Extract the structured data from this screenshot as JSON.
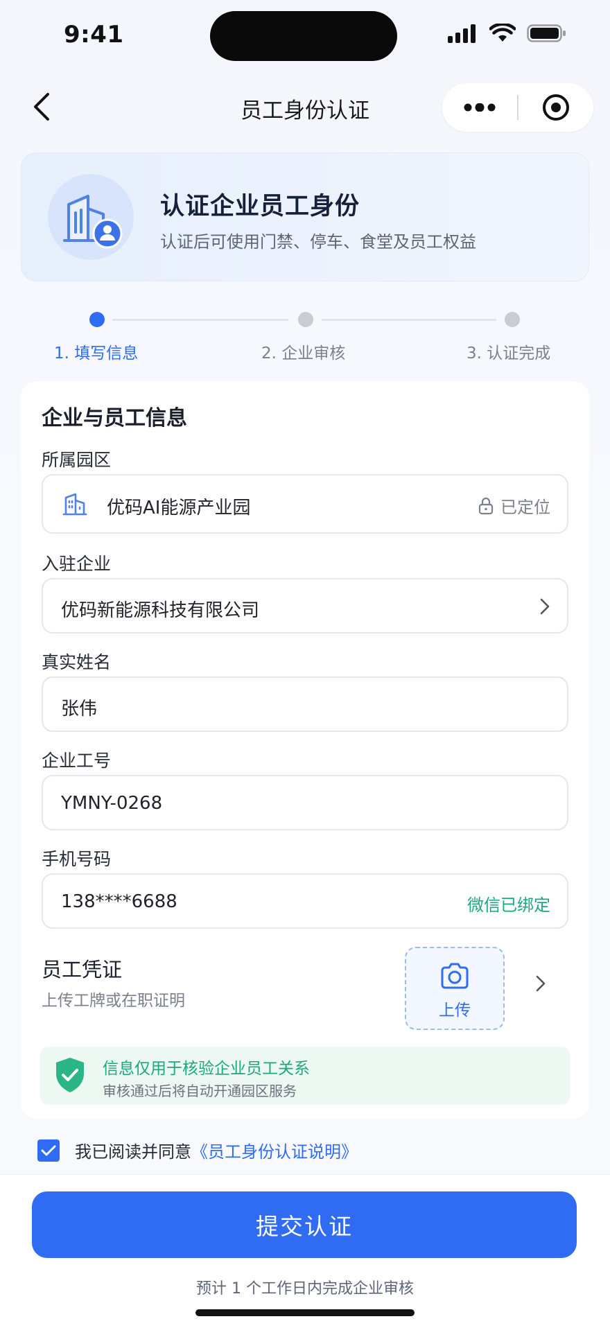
{
  "status_bar": {
    "time": "9:41"
  },
  "nav": {
    "title": "员工身份认证"
  },
  "banner": {
    "title": "认证企业员工身份",
    "subtitle": "认证后可使用门禁、停车、食堂及员工权益"
  },
  "steps": [
    {
      "label": "1. 填写信息",
      "active": true
    },
    {
      "label": "2. 企业审核",
      "active": false
    },
    {
      "label": "3. 认证完成",
      "active": false
    }
  ],
  "form": {
    "title": "企业与员工信息",
    "park": {
      "label": "所属园区",
      "value": "优码AI能源产业园",
      "status": "已定位"
    },
    "company": {
      "label": "入驻企业",
      "value": "优码新能源科技有限公司"
    },
    "name": {
      "label": "真实姓名",
      "value": "张伟"
    },
    "employee_id": {
      "label": "企业工号",
      "value": "YMNY-0268"
    },
    "phone": {
      "label": "手机号码",
      "value": "138****6688",
      "status": "微信已绑定"
    },
    "credential": {
      "title": "员工凭证",
      "subtitle": "上传工牌或在职证明",
      "upload_label": "上传"
    },
    "notice": {
      "title": "信息仅用于核验企业员工关系",
      "subtitle": "审核通过后将自动开通园区服务"
    }
  },
  "agreement": {
    "checked": true,
    "text": "我已阅读并同意",
    "link": "《员工身份认证说明》"
  },
  "footer": {
    "submit_label": "提交认证",
    "eta": "预计 1 个工作日内完成企业审核"
  },
  "colors": {
    "primary": "#2f6bf3",
    "success": "#1aa97d"
  }
}
